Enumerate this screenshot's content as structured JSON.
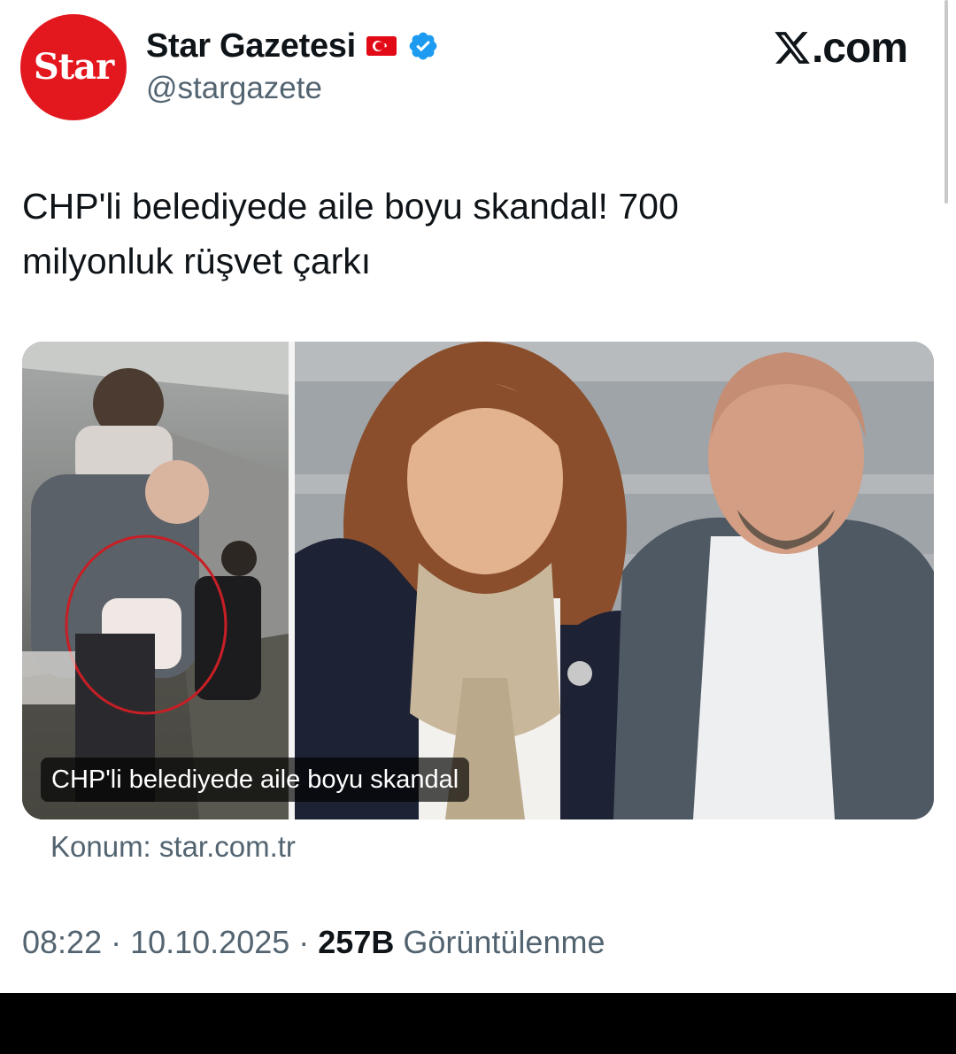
{
  "author": {
    "avatar_text": "Star",
    "display_name": "Star Gazetesi",
    "handle": "@stargazete",
    "flag": "turkey-flag-icon",
    "verified": "verified-badge-icon"
  },
  "site_brand": ".com",
  "tweet": {
    "text_line1": "CHP'li belediyede aile boyu skandal! 700",
    "text_line2": "milyonluk rüşvet çarkı"
  },
  "media": {
    "caption": "CHP'li belediyede aile boyu skandal"
  },
  "link": {
    "source": "Konum: star.com.tr"
  },
  "meta": {
    "time": "08:22",
    "sep1": " · ",
    "date": "10.10.2025",
    "sep2": " · ",
    "views": "257B",
    "views_label": " Görüntülenme"
  },
  "colors": {
    "brand_red": "#e3181f",
    "verified_blue": "#1d9bf0",
    "text_primary": "#0f1419",
    "text_secondary": "#536471"
  }
}
